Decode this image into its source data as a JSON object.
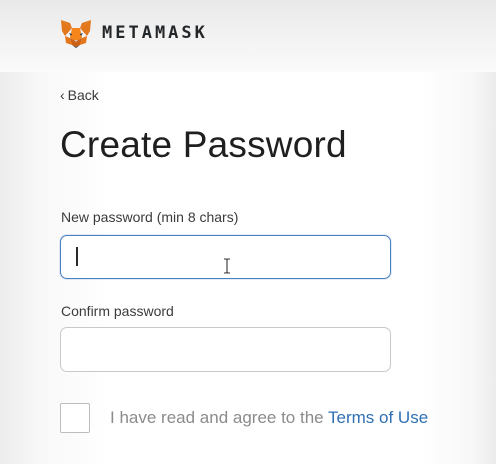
{
  "header": {
    "logo_icon": "metamask-fox-icon",
    "brand": "METAMASK"
  },
  "nav": {
    "back_chevron": "‹",
    "back_label": "Back"
  },
  "page": {
    "title": "Create Password"
  },
  "form": {
    "new_password": {
      "label": "New password (min 8 chars)",
      "value": ""
    },
    "confirm_password": {
      "label": "Confirm password",
      "value": ""
    },
    "agree": {
      "checked": false,
      "prefix": "I have read and agree to the ",
      "link_text": "Terms of Use"
    }
  },
  "colors": {
    "accent": "#2f70b4",
    "focus_border": "#4a7fc3",
    "fox_orange": "#e2761b"
  }
}
